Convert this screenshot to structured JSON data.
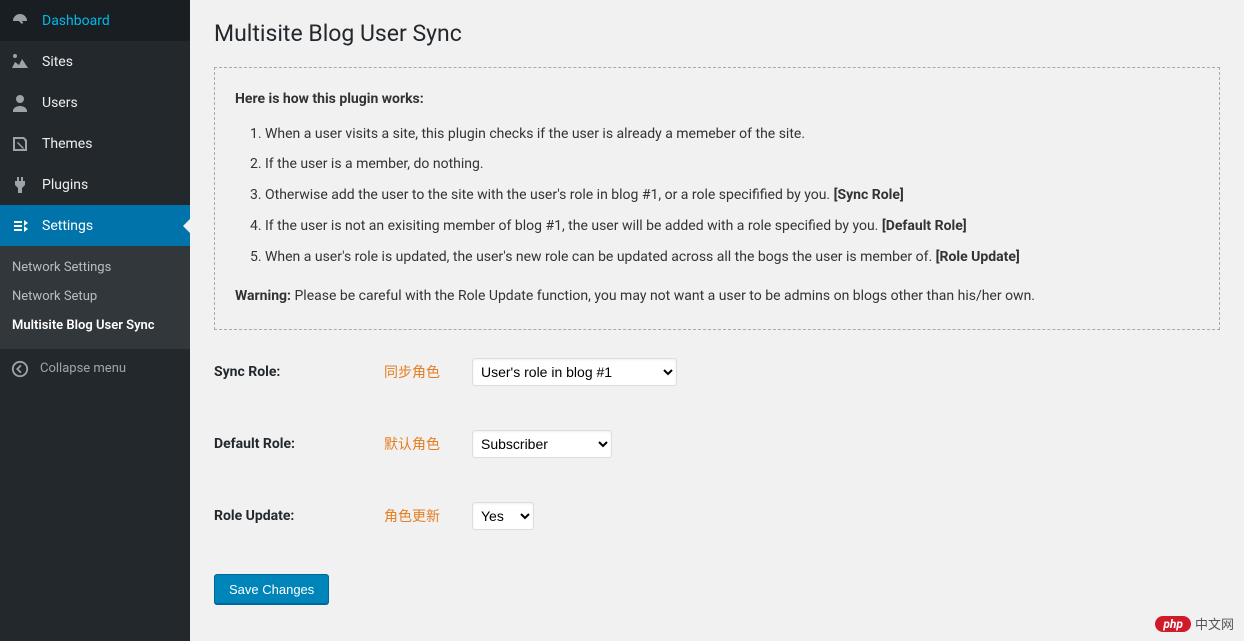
{
  "sidebar": {
    "items": [
      {
        "label": "Dashboard",
        "icon": "dashboard"
      },
      {
        "label": "Sites",
        "icon": "sites"
      },
      {
        "label": "Users",
        "icon": "users"
      },
      {
        "label": "Themes",
        "icon": "themes"
      },
      {
        "label": "Plugins",
        "icon": "plugins"
      },
      {
        "label": "Settings",
        "icon": "settings"
      }
    ],
    "sub": {
      "items": [
        {
          "label": "Network Settings"
        },
        {
          "label": "Network Setup"
        },
        {
          "label": "Multisite Blog User Sync"
        }
      ]
    },
    "collapse_label": "Collapse menu"
  },
  "page": {
    "title": "Multisite Blog User Sync"
  },
  "info": {
    "heading": "Here is how this plugin works:",
    "steps": [
      {
        "text": "When a user visits a site, this plugin checks if the user is already a memeber of the site."
      },
      {
        "text": "If the user is a member, do nothing."
      },
      {
        "text": "Otherwise add the user to the site with the user's role in blog #1, or a role specifified by you. ",
        "tag": "[Sync Role]"
      },
      {
        "text": "If the user is not an exisiting member of blog #1, the user will be added with a role specified by you. ",
        "tag": "[Default Role]"
      },
      {
        "text": "When a user's role is updated, the user's new role can be updated across all the bogs the user is member of. ",
        "tag": "[Role Update]"
      }
    ],
    "warning_label": "Warning:",
    "warning_text": " Please be careful with the Role Update function, you may not want a user to be admins on blogs other than his/her own."
  },
  "form": {
    "sync_role": {
      "label": "Sync Role:",
      "anno": "同步角色",
      "value": "User's role in blog #1"
    },
    "default_role": {
      "label": "Default Role:",
      "anno": "默认角色",
      "value": "Subscriber"
    },
    "role_update": {
      "label": "Role Update:",
      "anno": "角色更新",
      "value": "Yes"
    },
    "save_label": "Save Changes"
  },
  "watermark": {
    "badge": "php",
    "text": "中文网"
  }
}
